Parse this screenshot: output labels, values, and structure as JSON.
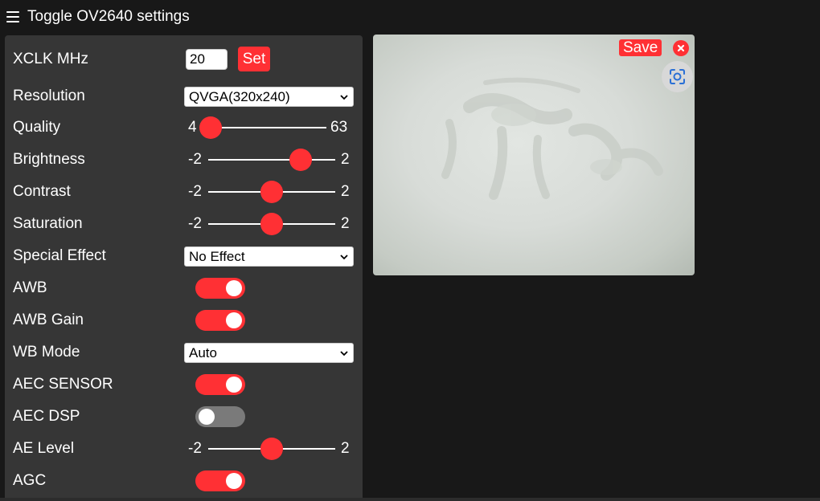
{
  "header": {
    "title": "Toggle OV2640 settings"
  },
  "settings": {
    "xclk": {
      "label": "XCLK MHz",
      "value": "20",
      "button": "Set"
    },
    "resolution": {
      "label": "Resolution",
      "value": "QVGA(320x240)"
    },
    "quality": {
      "label": "Quality",
      "min": "4",
      "max": "63",
      "value": 4,
      "range": [
        4,
        63
      ]
    },
    "brightness": {
      "label": "Brightness",
      "min": "-2",
      "max": "2",
      "value": 1,
      "range": [
        -2,
        2
      ]
    },
    "contrast": {
      "label": "Contrast",
      "min": "-2",
      "max": "2",
      "value": 0,
      "range": [
        -2,
        2
      ]
    },
    "saturation": {
      "label": "Saturation",
      "min": "-2",
      "max": "2",
      "value": 0,
      "range": [
        -2,
        2
      ]
    },
    "special_effect": {
      "label": "Special Effect",
      "value": "No Effect"
    },
    "awb": {
      "label": "AWB",
      "on": true
    },
    "awb_gain": {
      "label": "AWB Gain",
      "on": true
    },
    "wb_mode": {
      "label": "WB Mode",
      "value": "Auto"
    },
    "aec_sensor": {
      "label": "AEC SENSOR",
      "on": true
    },
    "aec_dsp": {
      "label": "AEC DSP",
      "on": false
    },
    "ae_level": {
      "label": "AE Level",
      "min": "-2",
      "max": "2",
      "value": 0,
      "range": [
        -2,
        2
      ]
    },
    "agc": {
      "label": "AGC",
      "on": true
    }
  },
  "stream": {
    "save_label": "Save",
    "icons": {
      "close": "close-icon",
      "fullscreen": "fullscreen-icon",
      "select": "chevron-down-icon",
      "menu": "hamburger-icon"
    }
  },
  "colors": {
    "accent": "#ff3034",
    "panel": "#363636",
    "background": "#181818",
    "toggle_off": "#7a7a7a"
  }
}
